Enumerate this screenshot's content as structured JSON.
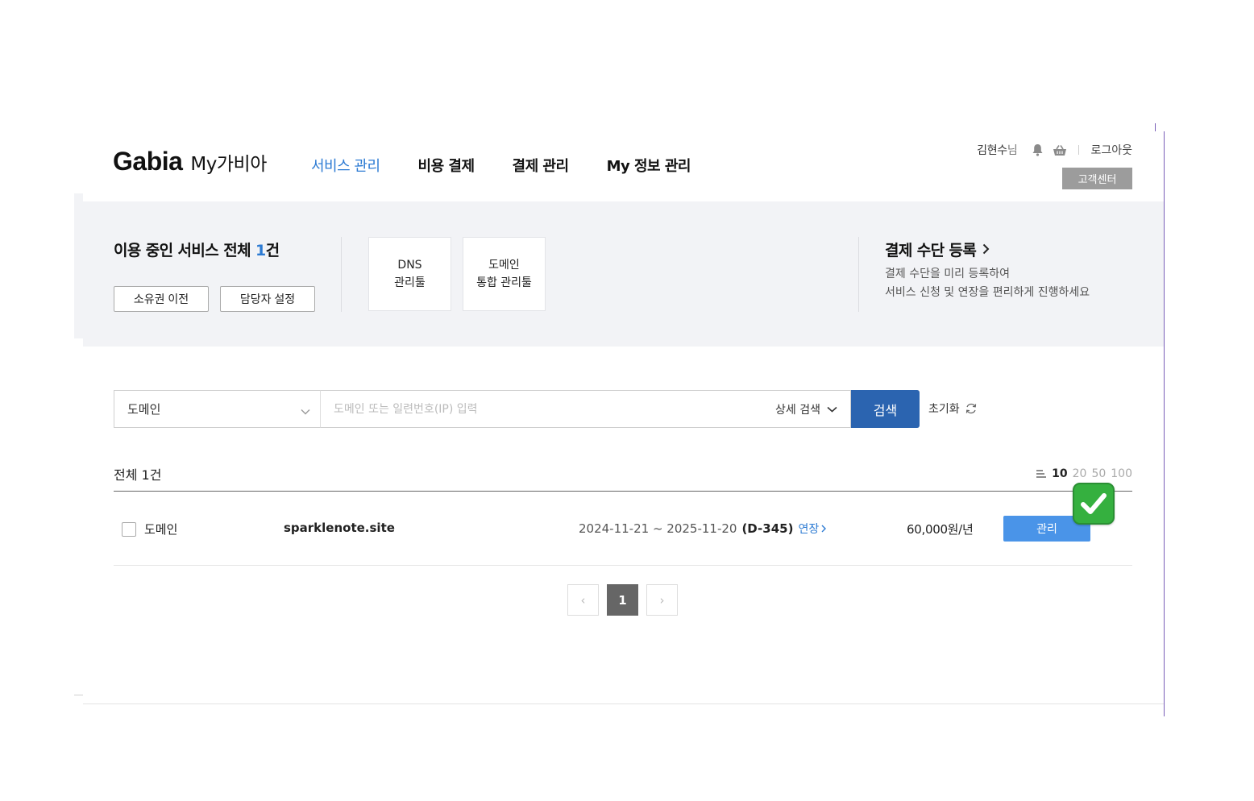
{
  "header": {
    "logo_main": "Gabia",
    "logo_sub": "My가비아",
    "nav": [
      {
        "label": "서비스 관리",
        "active": true
      },
      {
        "label": "비용 결제",
        "active": false
      },
      {
        "label": "결제 관리",
        "active": false
      },
      {
        "label": "My 정보 관리",
        "active": false
      }
    ],
    "user_name": "김현수",
    "user_suffix": "님",
    "logout_label": "로그아웃",
    "customer_center_label": "고객센터",
    "icons": [
      "bell-icon",
      "basket-icon"
    ]
  },
  "summary": {
    "title_prefix": "이용 중인 서비스 전체 ",
    "count": "1",
    "title_suffix": "건",
    "ownership_transfer_label": "소유권 이전",
    "manager_setting_label": "담당자 설정",
    "tools": [
      {
        "line1": "DNS",
        "line2": "관리툴"
      },
      {
        "line1": "도메인",
        "line2": "통합 관리툴"
      }
    ],
    "payment_title": "결제 수단 등록",
    "payment_desc_line1": "결제 수단을 미리 등록하여",
    "payment_desc_line2": "서비스 신청 및 연장을 편리하게 진행하세요"
  },
  "search": {
    "category_value": "도메인",
    "input_value": "",
    "input_placeholder": "도메인 또는 일련번호(IP) 입력",
    "detail_search_label": "상세 검색",
    "search_button_label": "검색",
    "reset_label": "초기화"
  },
  "list": {
    "total_label": "전체 1건",
    "page_size_options": [
      "10",
      "20",
      "50",
      "100"
    ],
    "page_size_selected": "10",
    "rows": [
      {
        "type": "도메인",
        "domain": "sparklenote.site",
        "period": "2024-11-21 ~ 2025-11-20",
        "dday": "(D-345)",
        "renew_label": "연장",
        "price": "60,000원/년",
        "manage_label": "관리",
        "checked": false
      }
    ]
  },
  "pagination": {
    "current": "1",
    "prev_symbol": "‹",
    "next_symbol": "›"
  },
  "colors": {
    "accent_blue": "#2d7bd3",
    "search_button": "#2b64b0",
    "manage_button": "#4a94e8",
    "band_bg": "#f2f3f6",
    "check_badge": "#35b03f"
  }
}
